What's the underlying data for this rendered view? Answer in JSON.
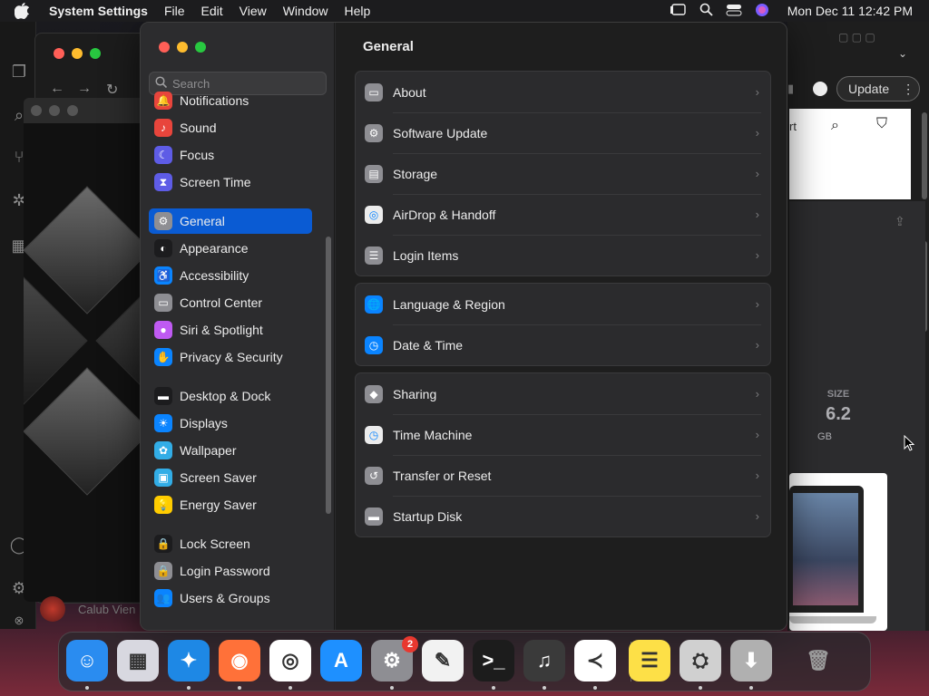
{
  "menubar": {
    "app_name": "System Settings",
    "menus": [
      "File",
      "Edit",
      "View",
      "Window",
      "Help"
    ],
    "clock": "Mon Dec 11  12:42 PM"
  },
  "background": {
    "update_button": "Update",
    "size_label": "SIZE",
    "size_value": "6.2",
    "size_unit": "GB",
    "partial_text": "rt",
    "window_caption": "Calub Vien"
  },
  "settings": {
    "search_placeholder": "Search",
    "sidebar": [
      {
        "label": "Notifications",
        "icon": "bell-icon",
        "color": "#e8453c"
      },
      {
        "label": "Sound",
        "icon": "speaker-icon",
        "color": "#e8453c"
      },
      {
        "label": "Focus",
        "icon": "moon-icon",
        "color": "#5e5ce6"
      },
      {
        "label": "Screen Time",
        "icon": "hourglass-icon",
        "color": "#5e5ce6"
      },
      {
        "label": "General",
        "icon": "gear-icon",
        "color": "#8e8e93",
        "selected": true
      },
      {
        "label": "Appearance",
        "icon": "appearance-icon",
        "color": "#1c1c1e"
      },
      {
        "label": "Accessibility",
        "icon": "accessibility-icon",
        "color": "#0a84ff"
      },
      {
        "label": "Control Center",
        "icon": "control-center-icon",
        "color": "#8e8e93"
      },
      {
        "label": "Siri & Spotlight",
        "icon": "siri-icon",
        "color": "#bf5af2"
      },
      {
        "label": "Privacy & Security",
        "icon": "hand-icon",
        "color": "#0a84ff"
      },
      {
        "label": "Desktop & Dock",
        "icon": "dock-icon",
        "color": "#1c1c1e"
      },
      {
        "label": "Displays",
        "icon": "sun-icon",
        "color": "#0a84ff"
      },
      {
        "label": "Wallpaper",
        "icon": "flower-icon",
        "color": "#32ade6"
      },
      {
        "label": "Screen Saver",
        "icon": "screensaver-icon",
        "color": "#32ade6"
      },
      {
        "label": "Energy Saver",
        "icon": "bulb-icon",
        "color": "#ffcc00"
      },
      {
        "label": "Lock Screen",
        "icon": "lock-icon",
        "color": "#1c1c1e"
      },
      {
        "label": "Login Password",
        "icon": "login-lock-icon",
        "color": "#8e8e93"
      },
      {
        "label": "Users & Groups",
        "icon": "users-icon",
        "color": "#0a84ff"
      }
    ],
    "title": "General",
    "groups": [
      [
        {
          "label": "About",
          "icon": "monitor-icon",
          "color": "#8e8e93"
        },
        {
          "label": "Software Update",
          "icon": "update-gear-icon",
          "color": "#8e8e93"
        },
        {
          "label": "Storage",
          "icon": "drive-icon",
          "color": "#8e8e93"
        },
        {
          "label": "AirDrop & Handoff",
          "icon": "airdrop-icon",
          "color": "#ececec"
        },
        {
          "label": "Login Items",
          "icon": "list-icon",
          "color": "#8e8e93"
        }
      ],
      [
        {
          "label": "Language & Region",
          "icon": "globe-icon",
          "color": "#0a84ff"
        },
        {
          "label": "Date & Time",
          "icon": "calendar-clock-icon",
          "color": "#0a84ff"
        }
      ],
      [
        {
          "label": "Sharing",
          "icon": "sharing-icon",
          "color": "#8e8e93"
        },
        {
          "label": "Time Machine",
          "icon": "time-machine-icon",
          "color": "#ececec"
        },
        {
          "label": "Transfer or Reset",
          "icon": "reset-icon",
          "color": "#8e8e93"
        },
        {
          "label": "Startup Disk",
          "icon": "disk-icon",
          "color": "#8e8e93"
        }
      ]
    ]
  },
  "dock": {
    "apps": [
      {
        "name": "finder-icon",
        "color": "#2a8cf0"
      },
      {
        "name": "launchpad-icon",
        "color": "#d8d8e0"
      },
      {
        "name": "safari-icon",
        "color": "#1e88e5"
      },
      {
        "name": "firefox-icon",
        "color": "#ff7139"
      },
      {
        "name": "chrome-icon",
        "color": "#ffffff"
      },
      {
        "name": "app-store-icon",
        "color": "#1e90ff"
      },
      {
        "name": "system-settings-icon",
        "color": "#8e8e93",
        "badge": "2"
      },
      {
        "name": "textedit-icon",
        "color": "#f2f2f2"
      },
      {
        "name": "terminal-icon",
        "color": "#1c1c1c"
      },
      {
        "name": "garageband-icon",
        "color": "#3a3a3a"
      },
      {
        "name": "vscode-icon",
        "color": "#ffffff"
      },
      {
        "name": "notes-icon",
        "color": "#fde047"
      },
      {
        "name": "disk-utility-icon",
        "color": "#d0d0d0"
      },
      {
        "name": "downloads-folder-icon",
        "color": "#b0b0b0"
      },
      {
        "name": "trash-icon",
        "color": "#7a7a7a"
      }
    ]
  }
}
